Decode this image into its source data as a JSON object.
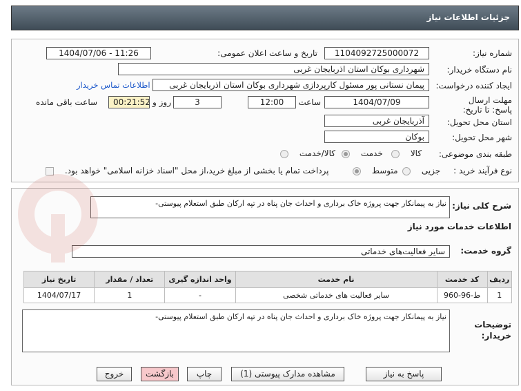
{
  "header": {
    "title": "جزئیات اطلاعات نیاز"
  },
  "fields": {
    "need_number_label": "شماره نیاز:",
    "need_number": "1104092725000072",
    "announce_label": "تاریخ و ساعت اعلان عمومی:",
    "announce_value": "1404/07/06 - 11:26",
    "buyer_org_label": "نام دستگاه خریدار:",
    "buyer_org": "شهرداری بوکان استان اذربایجان غربی",
    "creator_label": "ایجاد کننده درخواست:",
    "creator": "پیمان نستانی پور مسئول کارپردازی شهرداری بوکان استان اذربایجان غربی",
    "contact_link": "اطلاعات تماس خریدار",
    "deadline_label": "مهلت ارسال پاسخ: تا تاریخ:",
    "deadline_date": "1404/07/09",
    "time_label": "ساعت",
    "deadline_time": "12:00",
    "days_value": "3",
    "days_label": "روز و",
    "remaining_time": "00:21:52",
    "remaining_label": "ساعت باقی مانده",
    "province_label": "استان محل تحویل:",
    "province": "آذربایجان غربی",
    "city_label": "شهر محل تحویل:",
    "city": "بوکان",
    "category_label": "طبقه بندی موضوعی:",
    "category_options": [
      "کالا",
      "خدمت",
      "کالا/خدمت"
    ],
    "category_selected": "خدمت",
    "process_label": "نوع فرآیند خرید :",
    "process_options": [
      "جزیی",
      "متوسط"
    ],
    "process_selected": "متوسط",
    "payment_note": "پرداخت تمام یا بخشی از مبلغ خرید،از محل \"اسناد خزانه اسلامی\" خواهد بود."
  },
  "summary": {
    "label": "شرح کلی نیاز:",
    "text": "نیاز به پیمانکار جهت پروژه خاک برداری و احداث جان پناه در تپه ارکان طبق استعلام پیوستی-"
  },
  "services": {
    "section_title": "اطلاعات خدمات مورد نیاز",
    "group_label": "گروه خدمت:",
    "group_value": "سایر فعالیت‌های خدماتی",
    "columns": [
      "ردیف",
      "کد خدمت",
      "نام خدمت",
      "واحد اندازه گیری",
      "تعداد / مقدار",
      "تاریخ نیاز"
    ],
    "rows": [
      [
        "1",
        "ط-96-960",
        "سایر فعالیت های خدماتی شخصی",
        "-",
        "1",
        "1404/07/17"
      ]
    ]
  },
  "buyer_notes": {
    "label": "توضیحات خریدار:",
    "text": "نیاز به پیمانکار جهت پروژه خاک برداری و احداث جان پناه در تپه ارکان طبق استعلام پیوستی-"
  },
  "buttons": {
    "reply": "پاسخ به نیاز",
    "attachments": "مشاهده مدارک پیوستی (1)",
    "print": "چاپ",
    "back": "بازگشت",
    "exit": "خروج"
  },
  "watermark": "AriaTender.net",
  "colors": {
    "header": "#4f5c67",
    "remaining_bg": "#fbf2c6",
    "link": "#1a56c9",
    "back_btn": "#f7c8cb"
  }
}
